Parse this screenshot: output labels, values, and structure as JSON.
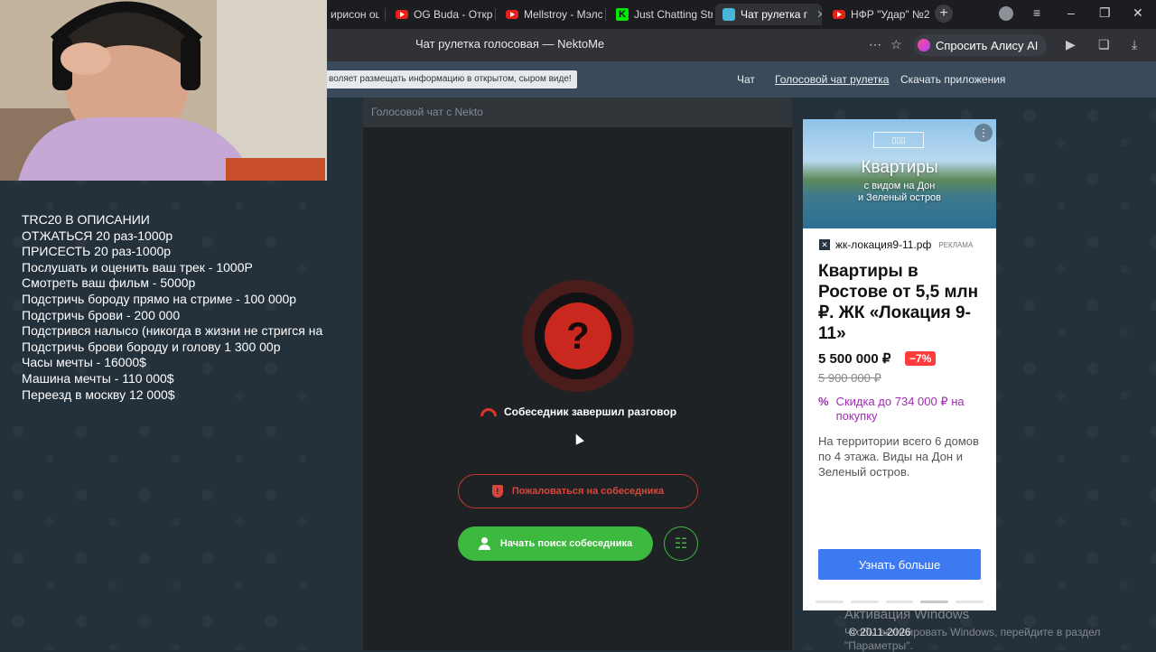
{
  "browser": {
    "tabs": [
      {
        "label": "ирисон оцени",
        "icon": "none"
      },
      {
        "label": "OG Buda - Открс",
        "icon": "youtube"
      },
      {
        "label": "Mellstroy - Мэлс",
        "icon": "youtube"
      },
      {
        "label": "Just Chatting Str",
        "icon": "kick"
      },
      {
        "label": "Чат рулетка г",
        "icon": "nekto",
        "active": true
      },
      {
        "label": "НФР \"Удар\" №2",
        "icon": "youtube"
      }
    ],
    "page_title": "Чат рулетка голосовая — NektoMe",
    "alice_label": "Спросить Алису AI"
  },
  "site": {
    "notice": "воляет размещать информацию в открытом, сыром виде!",
    "nav": [
      "Чат",
      "Голосовой чат рулетка",
      "Скачать приложения"
    ]
  },
  "chat": {
    "header": "Голосовой чат с Nekto",
    "avatar_symbol": "?",
    "status": "Собеседник завершил разговор",
    "report_label": "Пожаловаться на собеседника",
    "search_label": "Начать поиск собеседника"
  },
  "ad": {
    "image_headline": "Квартиры",
    "image_subline": "с видом на Дон\nи Зеленый остров",
    "domain": "жк-локация9-11.рф",
    "badge": "РЕКЛАМА",
    "title": "Квартиры в Ростове от 5,5 млн ₽. ЖК «Локация 9-11»",
    "price": "5 500 000 ₽",
    "discount": "−7%",
    "old_price": "5 900 000 ₽",
    "promo": "Скидка до 734 000 ₽ на покупку",
    "description": "На территории всего 6 домов по 4 этажа. Виды на Дон и Зеленый остров.",
    "cta": "Узнать больше",
    "pager_total": 5,
    "pager_current": 4
  },
  "footer": {
    "copyright": "© 2011-2026",
    "activation_title": "Активация Windows",
    "activation_line1": "Чтобы активировать Windows, перейдите в раздел",
    "activation_line2": "\"Параметры\"."
  },
  "stream_overlay": {
    "lines": [
      "TRC20 В ОПИСАНИИ",
      "ОТЖАТЬСЯ 20 раз-1000р",
      "ПРИСЕСТЬ 20 раз-1000р",
      "Послушать и оценить ваш трек - 1000Р",
      "Смотреть ваш фильм - 5000р",
      "Подстричь бороду прямо на стриме - 100 000р",
      "Подстричь брови - 200 000",
      "Подстрився налысо (никогда в жизни не стригся на",
      "Подстричь брови бороду и голову 1 300 00р",
      "Часы мечты - 16000$",
      "Машина мечты - 110 000$",
      "Переезд в москву 12 000$"
    ]
  }
}
